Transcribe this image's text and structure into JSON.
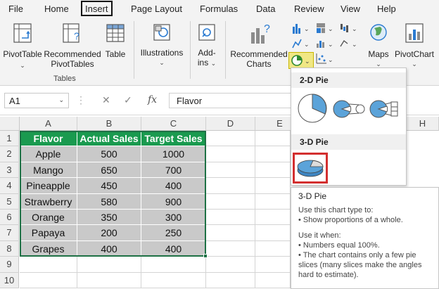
{
  "menu": [
    "File",
    "Home",
    "Insert",
    "Page Layout",
    "Formulas",
    "Data",
    "Review",
    "View",
    "Help"
  ],
  "ribbon": {
    "pivot_table": "PivotTable",
    "rec_pivot_line1": "Recommended",
    "rec_pivot_line2": "PivotTables",
    "table": "Table",
    "tables_group": "Tables",
    "illustrations": "Illustrations",
    "addins_line1": "Add-",
    "addins_line2": "ins",
    "rec_charts_line1": "Recommended",
    "rec_charts_line2": "Charts",
    "maps": "Maps",
    "pivot_chart": "PivotChart"
  },
  "formula_bar": {
    "cell_ref": "A1",
    "cancel": "✕",
    "enter": "✓",
    "fx": "fx",
    "content": "Flavor"
  },
  "columns": [
    "A",
    "B",
    "C",
    "D",
    "E",
    "H"
  ],
  "rows": [
    "1",
    "2",
    "3",
    "4",
    "5",
    "6",
    "7",
    "8",
    "9",
    "10"
  ],
  "table": {
    "headers": [
      "Flavor",
      "Actual Sales",
      "Target Sales"
    ],
    "rows": [
      [
        "Apple",
        "500",
        "1000"
      ],
      [
        "Mango",
        "650",
        "700"
      ],
      [
        "Pineapple",
        "450",
        "400"
      ],
      [
        "Strawberry",
        "580",
        "900"
      ],
      [
        "Orange",
        "350",
        "300"
      ],
      [
        "Papaya",
        "200",
        "250"
      ],
      [
        "Grapes",
        "400",
        "400"
      ]
    ]
  },
  "dropdown": {
    "section_2d": "2-D Pie",
    "section_3d": "3-D Pie"
  },
  "tooltip": {
    "title": "3-D Pie",
    "use_to": "Use this chart type to:",
    "use_to_1": "• Show proportions of a whole.",
    "use_when": "Use it when:",
    "use_when_1": "• Numbers equal 100%.",
    "use_when_2": "• The chart contains only a few pie",
    "use_when_3": "slices (many slices make the angles",
    "use_when_4": "hard to estimate)."
  },
  "colors": {
    "header_green": "#1a9a4f",
    "data_gray": "#c9c9c9",
    "highlight_red": "#d32f2f",
    "pie_blue": "#5ba3d9"
  }
}
